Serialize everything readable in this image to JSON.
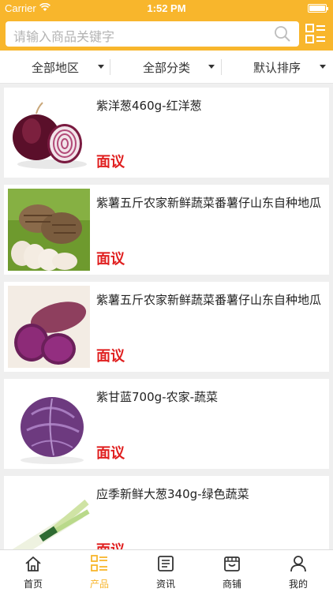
{
  "status_bar": {
    "carrier": "Carrier",
    "time": "1:52 PM"
  },
  "search": {
    "placeholder": "请输入商品关键字"
  },
  "filters": [
    {
      "label": "全部地区"
    },
    {
      "label": "全部分类"
    },
    {
      "label": "默认排序"
    }
  ],
  "products": [
    {
      "title": "紫洋葱460g-红洋葱",
      "price": "面议",
      "image": "red-onion"
    },
    {
      "title": "紫薯五斤农家新鲜蔬菜番薯仔山东自种地瓜",
      "price": "面议",
      "image": "taro"
    },
    {
      "title": "紫薯五斤农家新鲜蔬菜番薯仔山东自种地瓜",
      "price": "面议",
      "image": "purple-sweet-potato"
    },
    {
      "title": "紫甘蓝700g-农家-蔬菜",
      "price": "面议",
      "image": "red-cabbage"
    },
    {
      "title": "应季新鲜大葱340g-绿色蔬菜",
      "price": "面议",
      "image": "green-onion"
    }
  ],
  "tabbar": {
    "active_color": "#f8b62c",
    "items": [
      {
        "label": "首页",
        "icon": "home-icon"
      },
      {
        "label": "产品",
        "icon": "product-grid-icon"
      },
      {
        "label": "资讯",
        "icon": "news-icon"
      },
      {
        "label": "商铺",
        "icon": "shop-icon"
      },
      {
        "label": "我的",
        "icon": "user-icon"
      }
    ]
  },
  "colors": {
    "brand": "#f8b62c",
    "price": "#e02020"
  }
}
